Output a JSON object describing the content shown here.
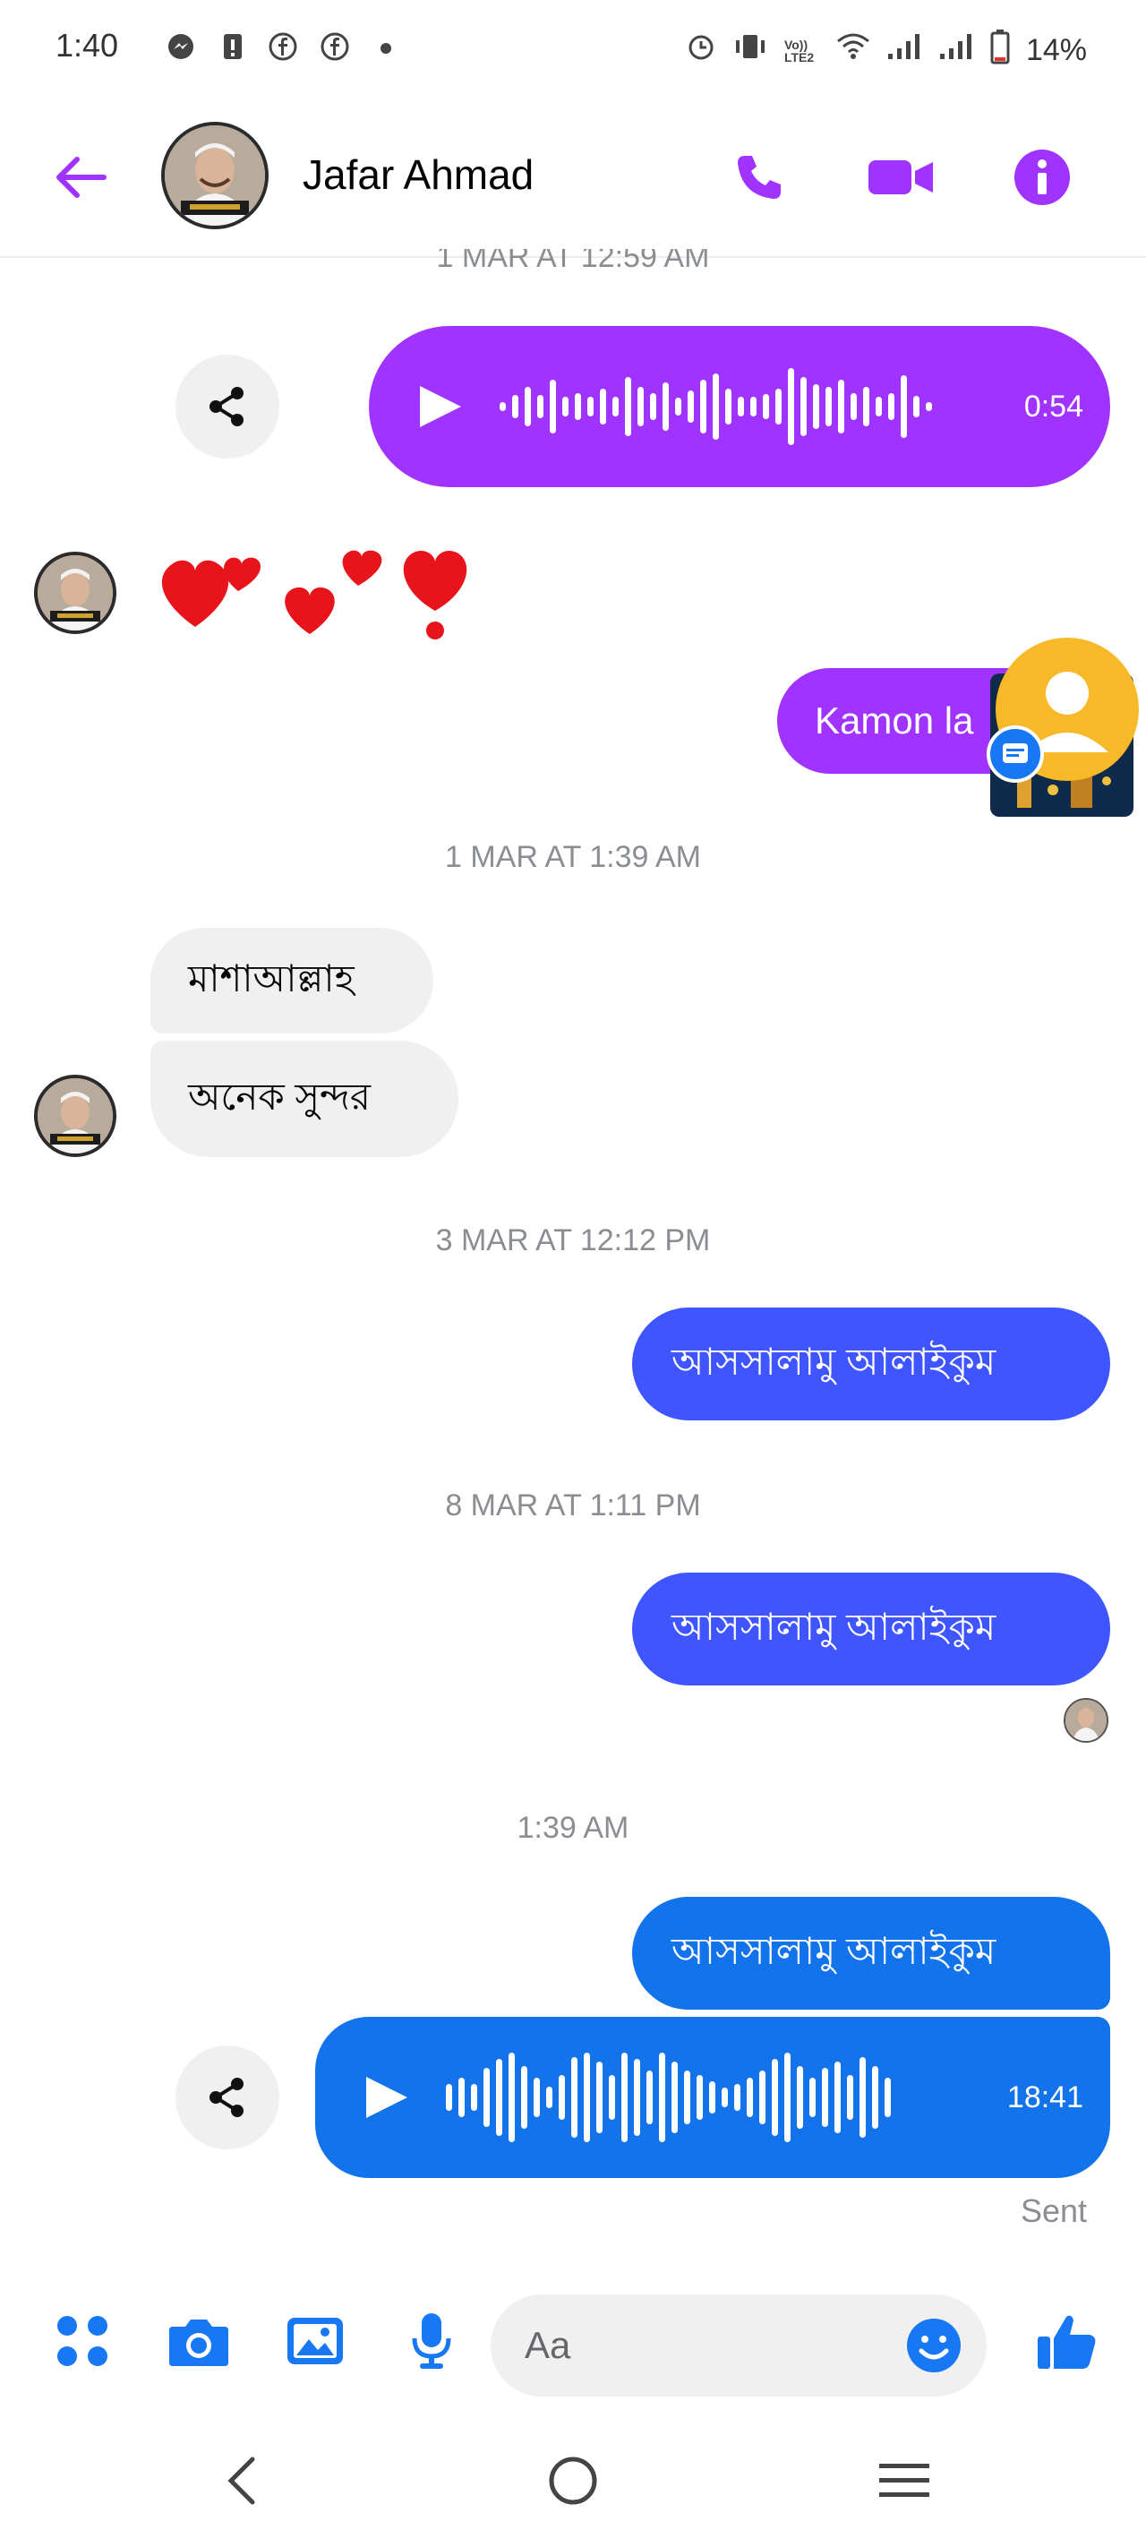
{
  "status_bar": {
    "time": "1:40",
    "battery": "14%",
    "icons": [
      "messenger-icon",
      "notification-icon",
      "facebook-icon",
      "facebook-icon",
      "dot-icon",
      "alarm-icon",
      "vibrate-icon",
      "volte-icon",
      "wifi-icon",
      "signal-icon",
      "signal-icon",
      "battery-icon"
    ],
    "volte_label": "Vo)) LTE2"
  },
  "header": {
    "contact_name": "Jafar Ahmad",
    "icons": [
      "back-arrow-icon",
      "phone-icon",
      "video-camera-icon",
      "info-icon"
    ],
    "accent_color": "#a033ff"
  },
  "conversation": {
    "cut_timestamp": "1 MAR AT 12:59 AM",
    "voice_1": {
      "duration": "0:54",
      "color": "#a033ff"
    },
    "hearts_emoji": "💕💕❣️",
    "outgoing_1": "Kamon la",
    "timestamp_1": "1 MAR AT 1:39 AM",
    "incoming_1": "মাশাআল্লাহ",
    "incoming_2": "অনেক সুন্দর",
    "timestamp_2": "3 MAR AT 12:12 PM",
    "outgoing_2": "আসসালামু আলাইকুম",
    "timestamp_3": "8 MAR AT 1:11 PM",
    "outgoing_3": "আসসালামু আলাইকুম",
    "timestamp_4": "1:39 AM",
    "outgoing_4": "আসসালামু আলাইকুম",
    "voice_2": {
      "duration": "18:41",
      "color": "#1273eb"
    },
    "status": "Sent"
  },
  "composer": {
    "placeholder": "Aa",
    "icons": [
      "menu-dots-icon",
      "camera-icon",
      "gallery-icon",
      "microphone-icon",
      "emoji-icon",
      "thumbs-up-icon"
    ],
    "accent_color": "#1877f2"
  },
  "nav_bar": {
    "icons": [
      "nav-back-icon",
      "nav-home-icon",
      "nav-recents-icon"
    ]
  }
}
